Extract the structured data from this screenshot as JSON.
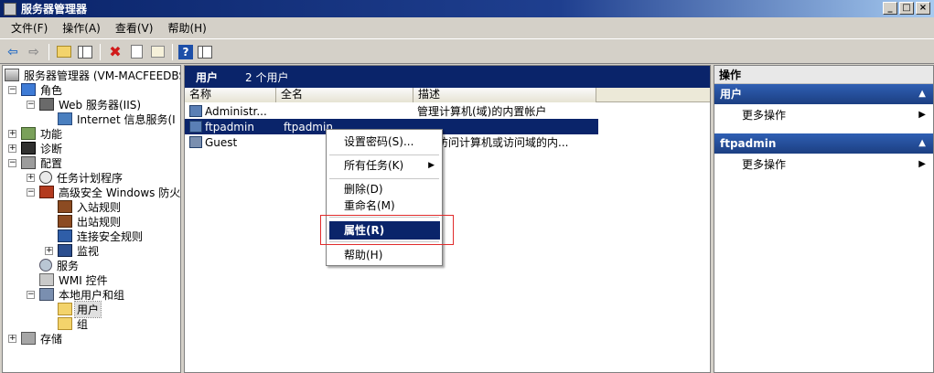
{
  "window": {
    "title": "服务器管理器",
    "controls": [
      "_",
      "□",
      "×"
    ]
  },
  "menubar": {
    "items": [
      "文件(F)",
      "操作(A)",
      "查看(V)",
      "帮助(H)"
    ]
  },
  "toolbar": {
    "icons": [
      "back-arrow-icon",
      "forward-arrow-icon",
      "up-folder-icon",
      "show-hide-tree-icon",
      "delete-icon",
      "properties-icon",
      "export-list-icon",
      "help-icon",
      "action-pane-icon"
    ]
  },
  "tree": {
    "root": "服务器管理器 (VM-MACFEEDBSJ)",
    "roles": "角色",
    "web_server": "Web 服务器(IIS)",
    "iis_manager": "Internet 信息服务(I",
    "features": "功能",
    "diagnostics": "诊断",
    "configuration": "配置",
    "task_scheduler": "任务计划程序",
    "firewall": "高级安全 Windows 防火墙",
    "inbound": "入站规则",
    "outbound": "出站规则",
    "connection_rules": "连接安全规则",
    "monitoring": "监视",
    "services": "服务",
    "wmi": "WMI 控件",
    "local_users": "本地用户和组",
    "users": "用户",
    "groups": "组",
    "storage": "存储"
  },
  "center": {
    "title": "用户",
    "count": "2 个用户",
    "columns": [
      "名称",
      "全名",
      "描述"
    ],
    "rows": [
      {
        "name": "Administr...",
        "fullname": "",
        "desc": "管理计算机(域)的内置帐户"
      },
      {
        "name": "ftpadmin",
        "fullname": "ftpadmin",
        "desc": ""
      },
      {
        "name": "Guest",
        "fullname": "",
        "desc": "宾访问计算机或访问域的内..."
      }
    ]
  },
  "context_menu": {
    "set_password": "设置密码(S)...",
    "all_tasks": "所有任务(K)",
    "delete": "删除(D)",
    "rename": "重命名(M)",
    "properties": "属性(R)",
    "help": "帮助(H)"
  },
  "actions": {
    "title": "操作",
    "group1": "用户",
    "group1_item": "更多操作",
    "group2": "ftpadmin",
    "group2_item": "更多操作"
  }
}
